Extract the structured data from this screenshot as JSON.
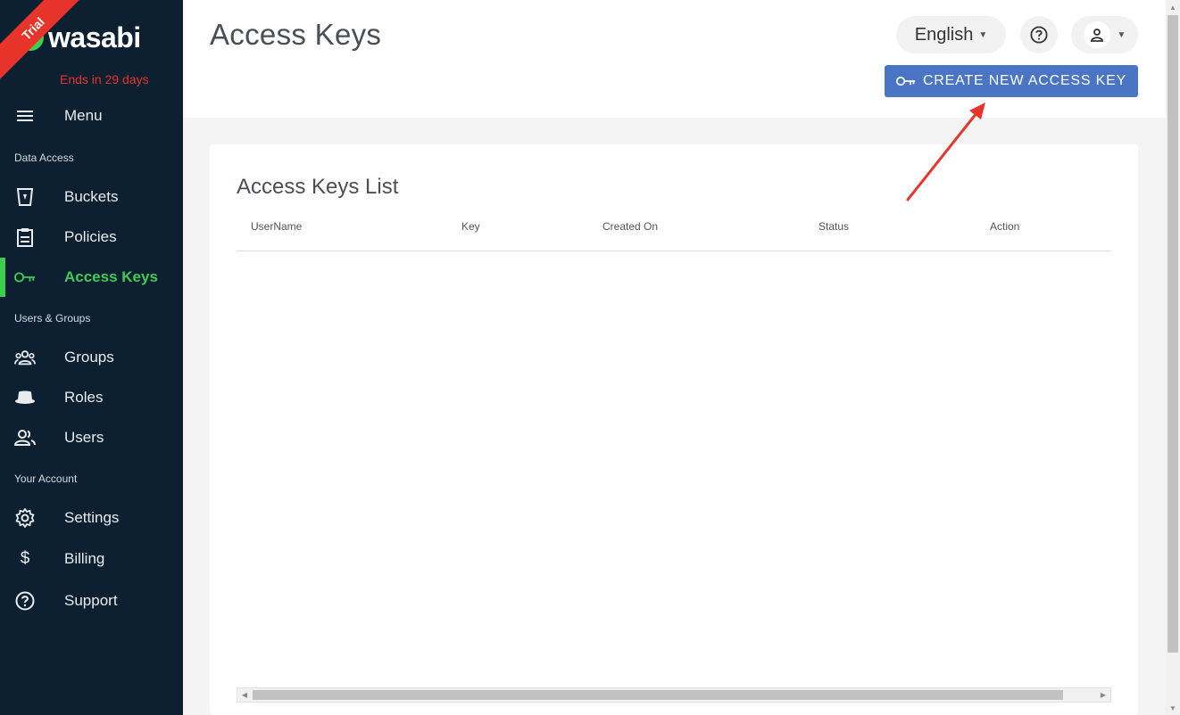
{
  "brand": {
    "trial_label": "Trial",
    "logo_text": "wasabi",
    "trial_ends": "Ends in 29 days"
  },
  "sidebar": {
    "menu_label": "Menu",
    "sections": {
      "data_access": "Data Access",
      "users_groups": "Users & Groups",
      "your_account": "Your Account"
    },
    "items": [
      {
        "label": "Buckets",
        "icon": "bucket-icon"
      },
      {
        "label": "Policies",
        "icon": "clipboard-icon"
      },
      {
        "label": "Access Keys",
        "icon": "key-icon",
        "active": true
      },
      {
        "label": "Groups",
        "icon": "groups-icon"
      },
      {
        "label": "Roles",
        "icon": "hat-icon"
      },
      {
        "label": "Users",
        "icon": "users-icon"
      },
      {
        "label": "Settings",
        "icon": "gear-icon"
      },
      {
        "label": "Billing",
        "icon": "dollar-icon"
      },
      {
        "label": "Support",
        "icon": "help-icon"
      }
    ]
  },
  "header": {
    "title": "Access Keys",
    "language": "English",
    "create_button": "CREATE NEW ACCESS KEY"
  },
  "card": {
    "title": "Access Keys List",
    "columns": [
      "UserName",
      "Key",
      "Created On",
      "Status",
      "Action"
    ]
  },
  "colors": {
    "sidebar_bg": "#0c2031",
    "accent_green": "#3fcc52",
    "trial_red": "#e8332a",
    "button_blue": "#4a75c4"
  }
}
